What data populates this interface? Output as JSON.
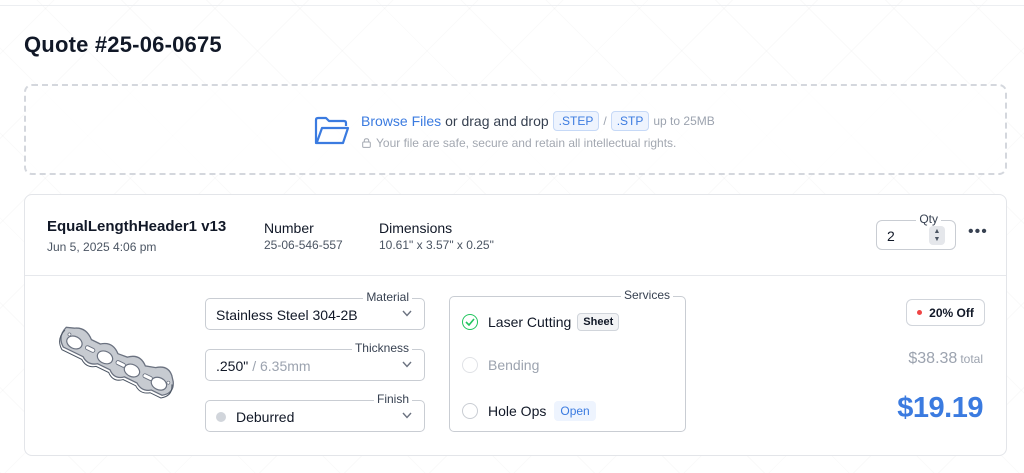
{
  "page": {
    "title": "Quote #25-06-0675"
  },
  "upload": {
    "browse_label": "Browse Files",
    "drag_text": "or drag and drop",
    "formats": [
      ".STEP",
      ".STP"
    ],
    "separator": "/",
    "size_limit": "up to 25MB",
    "security_note": "Your file are safe, secure and retain all intellectual rights.",
    "icons": {
      "folder": "folder-icon",
      "lock": "lock-icon"
    }
  },
  "part": {
    "name": "EqualLengthHeader1 v13",
    "date": "Jun 5, 2025 4:06 pm",
    "number_label": "Number",
    "number_value": "25-06-546-557",
    "dimensions_label": "Dimensions",
    "dimensions_value": "10.61\" x 3.57\" x 0.25\"",
    "qty_label": "Qty",
    "qty_value": "2",
    "more_icon": "more-horizontal-icon"
  },
  "material": {
    "label": "Material",
    "value": "Stainless Steel 304-2B"
  },
  "thickness": {
    "label": "Thickness",
    "value": ".250\"",
    "secondary": "/ 6.35mm"
  },
  "finish": {
    "label": "Finish",
    "value": "Deburred"
  },
  "services": {
    "label": "Services",
    "items": [
      {
        "label": "Laser Cutting",
        "tag": "Sheet",
        "state": "checked"
      },
      {
        "label": "Bending",
        "tag": "",
        "state": "disabled"
      },
      {
        "label": "Hole Ops",
        "tag": "Open",
        "state": "unchecked"
      }
    ]
  },
  "pricing": {
    "discount": "20% Off",
    "total_price": "$38.38",
    "total_label": "total",
    "unit_price": "$19.19"
  },
  "colors": {
    "accent": "#3b7be0",
    "success": "#22c55e",
    "danger": "#ef4444"
  }
}
